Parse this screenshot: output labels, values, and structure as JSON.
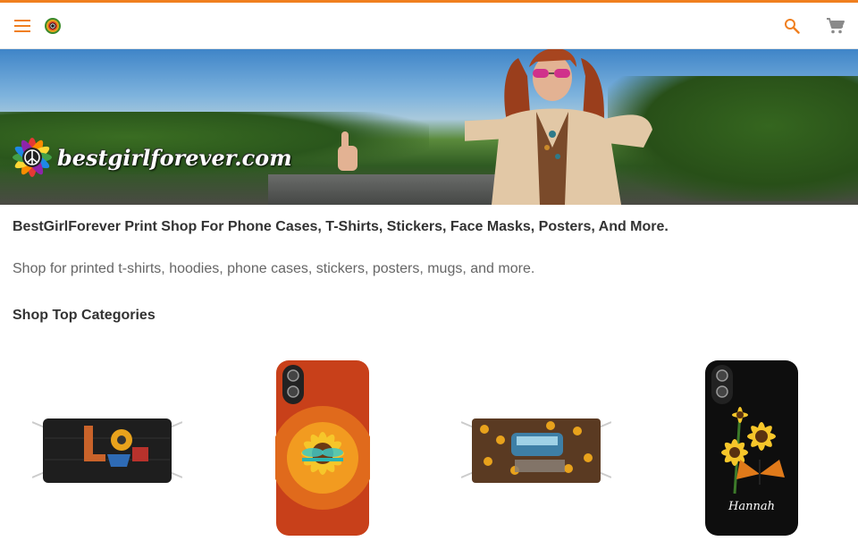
{
  "header": {
    "menu_icon": "menu-icon",
    "logo_icon": "peace-flower-icon",
    "search_icon": "search-icon",
    "cart_icon": "shopping-cart-icon",
    "accent": "#f07f1f"
  },
  "banner": {
    "logo_text": "bestgirlforever.com"
  },
  "main": {
    "headline": "BestGirlForever Print Shop For Phone Cases, T-Shirts, Stickers, Face Masks, Posters, And More.",
    "subline": "Shop for printed t-shirts, hoodies, phone cases, stickers, posters, mugs, and more.",
    "section_title": "Shop Top Categories"
  },
  "products": [
    {
      "type": "face-mask",
      "design": "love-flag"
    },
    {
      "type": "phone-case",
      "design": "sunflower-dragonfly"
    },
    {
      "type": "face-mask",
      "design": "sunflower-love-van"
    },
    {
      "type": "phone-case",
      "design": "sunflower-butterfly",
      "name_text": "Hannah"
    }
  ]
}
